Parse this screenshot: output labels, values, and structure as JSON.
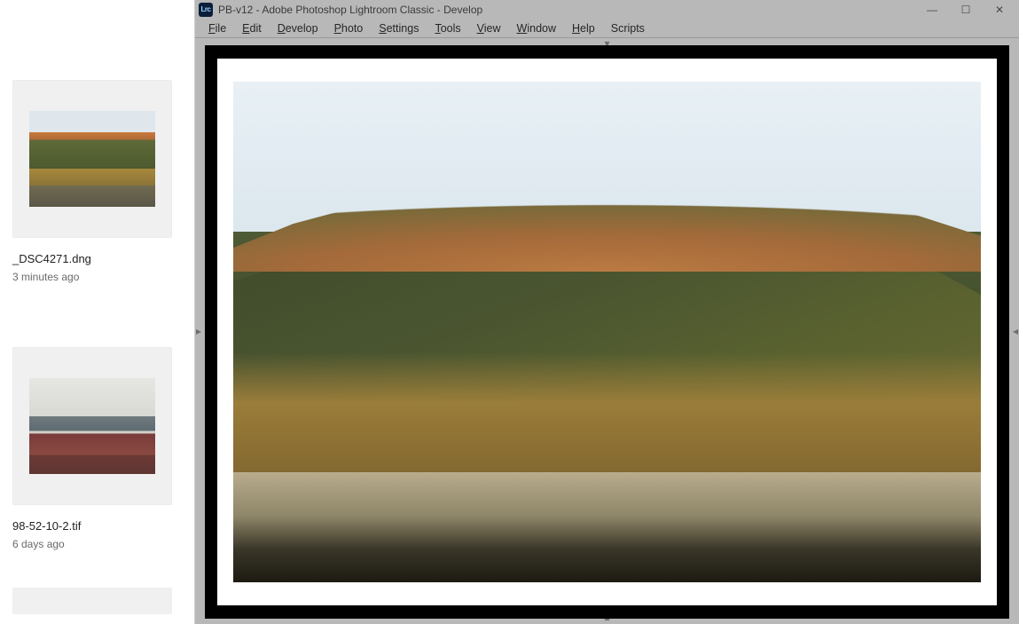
{
  "sidebar": {
    "files": [
      {
        "name": "_DSC4271.dng",
        "time": "3 minutes ago"
      },
      {
        "name": "98-52-10-2.tif",
        "time": "6 days ago"
      }
    ]
  },
  "window": {
    "app_icon_text": "Lrc",
    "title": "PB-v12 - Adobe Photoshop Lightroom Classic - Develop"
  },
  "menu": {
    "file": "File",
    "edit": "Edit",
    "develop": "Develop",
    "photo": "Photo",
    "settings": "Settings",
    "tools": "Tools",
    "view": "View",
    "window": "Window",
    "help": "Help",
    "scripts": "Scripts"
  },
  "icons": {
    "minimize": "—",
    "maximize": "☐",
    "close": "✕",
    "tri_down": "▾",
    "tri_up": "▴",
    "tri_left": "◂",
    "tri_right": "▸"
  }
}
